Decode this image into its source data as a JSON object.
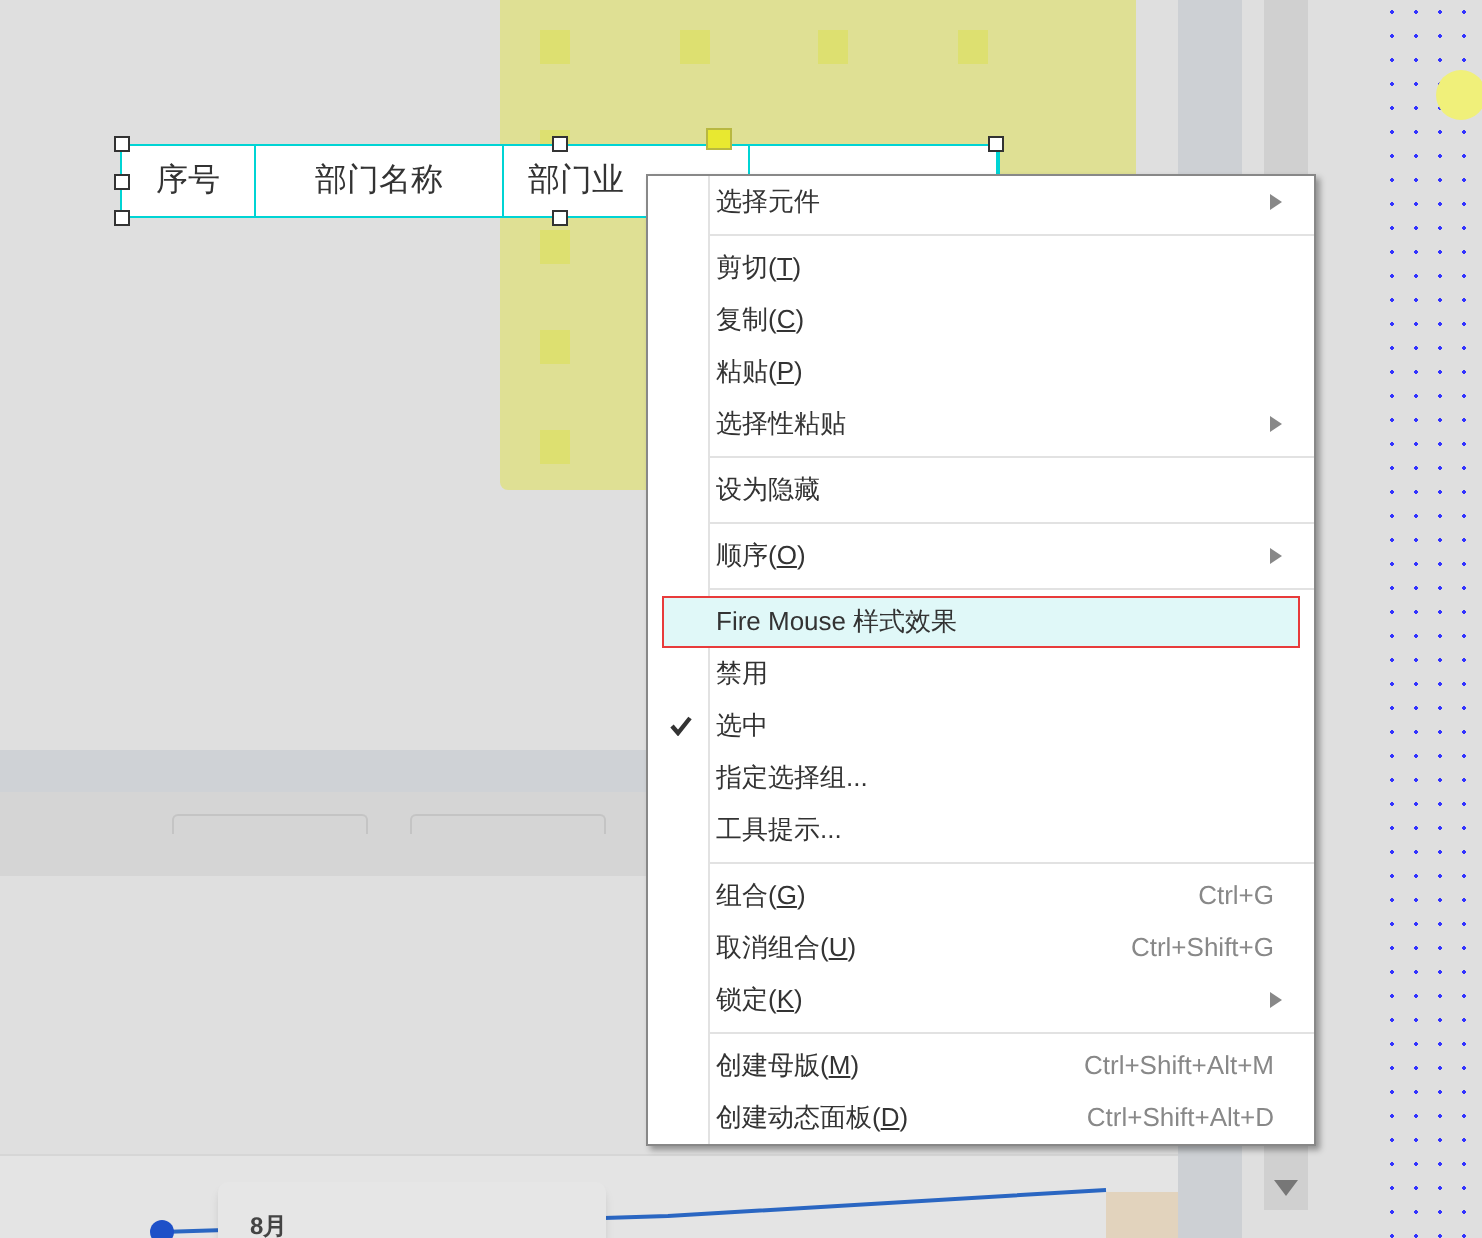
{
  "table_header": {
    "cells": [
      {
        "label": "序号"
      },
      {
        "label": "部门名称"
      },
      {
        "label": "部门业"
      }
    ]
  },
  "context_menu": {
    "groups": [
      [
        {
          "label": "选择元件",
          "submenu": true,
          "checked": false,
          "highlighted": false
        }
      ],
      [
        {
          "label": "剪切",
          "mnemonic": "(T)",
          "submenu": false,
          "checked": false,
          "highlighted": false
        },
        {
          "label": "复制",
          "mnemonic": "(C)",
          "submenu": false,
          "checked": false,
          "highlighted": false
        },
        {
          "label": "粘贴",
          "mnemonic": "(P)",
          "submenu": false,
          "checked": false,
          "highlighted": false
        },
        {
          "label": "选择性粘贴",
          "submenu": true,
          "checked": false,
          "highlighted": false
        }
      ],
      [
        {
          "label": "设为隐藏",
          "submenu": false,
          "checked": false,
          "highlighted": false
        }
      ],
      [
        {
          "label": "顺序",
          "mnemonic": "(O)",
          "submenu": true,
          "checked": false,
          "highlighted": false
        }
      ],
      [
        {
          "label": "Fire Mouse 样式效果",
          "submenu": false,
          "checked": false,
          "highlighted": true
        },
        {
          "label": "禁用",
          "submenu": false,
          "checked": false,
          "highlighted": false
        },
        {
          "label": "选中",
          "submenu": false,
          "checked": true,
          "highlighted": false
        },
        {
          "label": "指定选择组...",
          "submenu": false,
          "checked": false,
          "highlighted": false
        },
        {
          "label": "工具提示...",
          "submenu": false,
          "checked": false,
          "highlighted": false
        }
      ],
      [
        {
          "label": "组合",
          "mnemonic": "(G)",
          "shortcut": "Ctrl+G",
          "submenu": false,
          "checked": false,
          "highlighted": false
        },
        {
          "label": "取消组合",
          "mnemonic": "(U)",
          "shortcut": "Ctrl+Shift+G",
          "submenu": false,
          "checked": false,
          "highlighted": false
        },
        {
          "label": "锁定",
          "mnemonic": "(K)",
          "submenu": true,
          "checked": false,
          "highlighted": false
        }
      ],
      [
        {
          "label": "创建母版",
          "mnemonic": "(M)",
          "shortcut": "Ctrl+Shift+Alt+M",
          "submenu": false,
          "checked": false,
          "highlighted": false
        },
        {
          "label": "创建动态面板",
          "mnemonic": "(D)",
          "shortcut": "Ctrl+Shift+Alt+D",
          "submenu": false,
          "checked": false,
          "highlighted": false
        }
      ]
    ]
  },
  "tooltip": {
    "title": "8月"
  }
}
